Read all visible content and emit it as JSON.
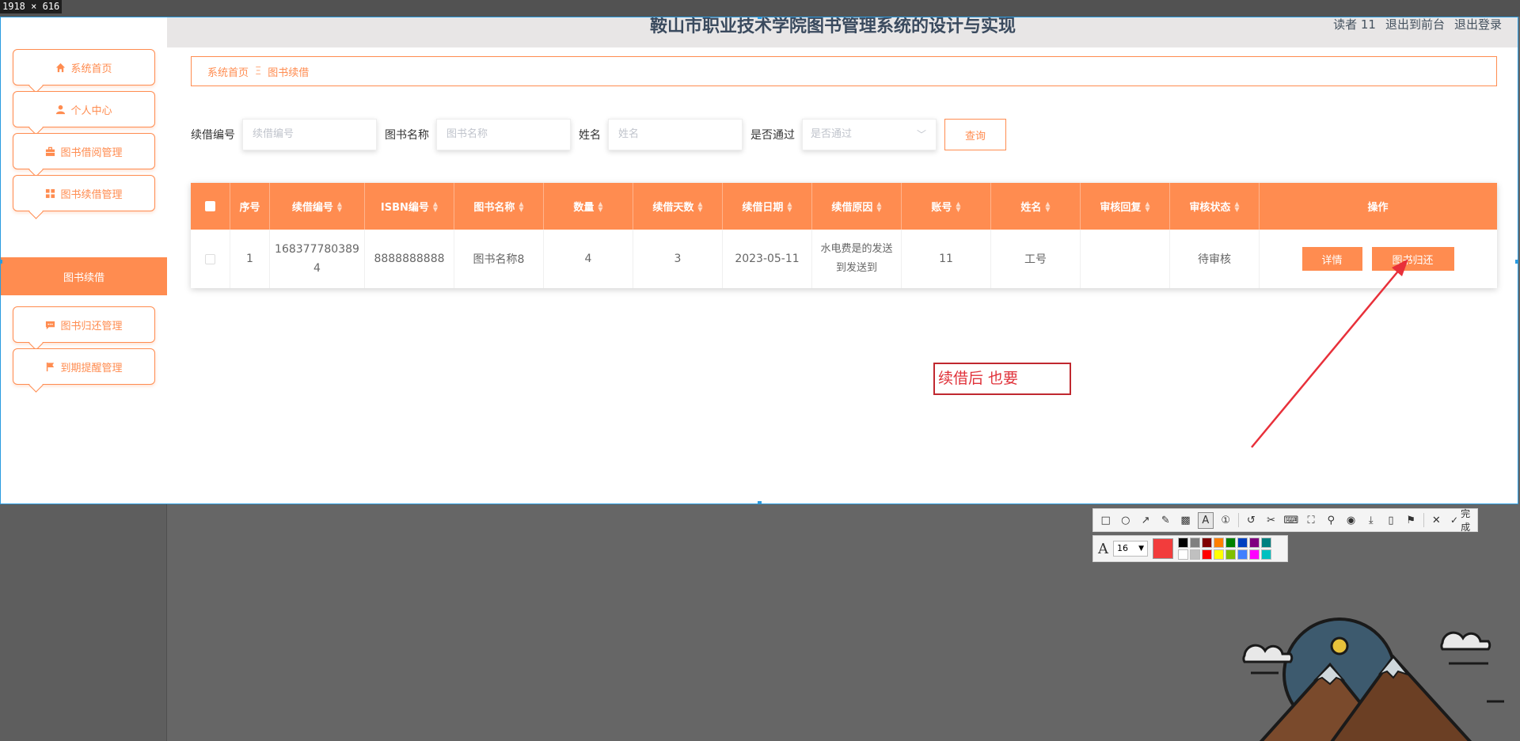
{
  "screenshot_size_label": "1918 × 616",
  "app": {
    "title": "鞍山市职业技术学院图书管理系统的设计与实现",
    "header_right": [
      "读者 11",
      "退出到前台",
      "退出登录"
    ]
  },
  "sidebar": {
    "items": [
      {
        "label": "系统首页",
        "icon": "home-icon"
      },
      {
        "label": "个人中心",
        "icon": "user-icon"
      },
      {
        "label": "图书借阅管理",
        "icon": "briefcase-icon"
      },
      {
        "label": "图书续借管理",
        "icon": "grid-icon"
      },
      {
        "label": "图书归还管理",
        "icon": "chat-icon"
      },
      {
        "label": "到期提醒管理",
        "icon": "flag-icon"
      }
    ],
    "active_sub": "图书续借"
  },
  "breadcrumb": {
    "home": "系统首页",
    "separator": "Ξ",
    "current": "图书续借"
  },
  "search": {
    "fields": [
      {
        "label": "续借编号",
        "placeholder": "续借编号"
      },
      {
        "label": "图书名称",
        "placeholder": "图书名称"
      },
      {
        "label": "姓名",
        "placeholder": "姓名"
      }
    ],
    "select": {
      "label": "是否通过",
      "placeholder": "是否通过"
    },
    "button": "查询"
  },
  "table": {
    "headers": [
      "序号",
      "续借编号",
      "ISBN编号",
      "图书名称",
      "数量",
      "续借天数",
      "续借日期",
      "续借原因",
      "账号",
      "姓名",
      "审核回复",
      "审核状态",
      "操作"
    ],
    "rows": [
      {
        "index": "1",
        "renew_no": "1683777803894",
        "isbn": "8888888888",
        "book_name": "图书名称8",
        "quantity": "4",
        "renew_days": "3",
        "renew_date": "2023-05-11",
        "reason": "水电费是的发送到发送到",
        "account": "11",
        "name": "工号",
        "review_reply": "",
        "review_status": "待审核",
        "actions": [
          "详情",
          "图书归还"
        ]
      }
    ]
  },
  "annotation": {
    "text": "续借后 也要",
    "color": "#e0323a"
  },
  "screenshot_tool": {
    "done_label": "完成",
    "font_size": "16",
    "current_color": "#f23c3c",
    "palette": [
      "#000000",
      "#808080",
      "#800000",
      "#ff8000",
      "#008000",
      "#0040c0",
      "#800080",
      "#008080",
      "#ffffff",
      "#c0c0c0",
      "#ff0000",
      "#ffff00",
      "#80c000",
      "#4080ff",
      "#ff00ff",
      "#00c0c0"
    ]
  },
  "colors": {
    "accent": "#ff8c50",
    "title": "#3a4a5e"
  }
}
